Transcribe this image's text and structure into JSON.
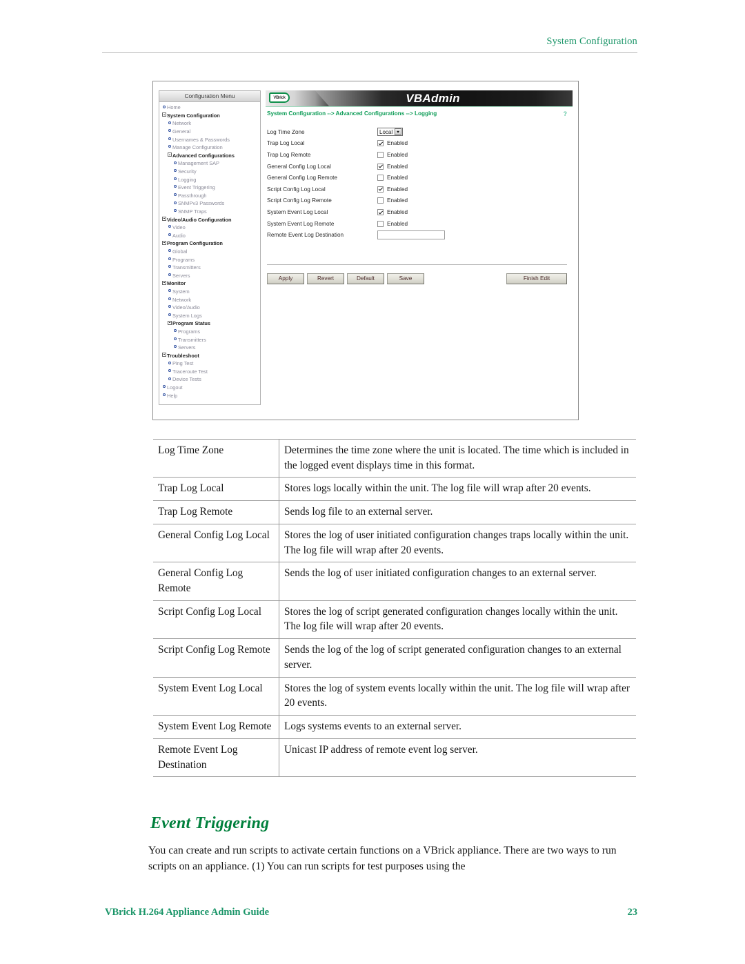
{
  "page": {
    "running_head": "System Configuration",
    "footer_left": "VBrick H.264 Appliance Admin Guide",
    "footer_page_number": "23"
  },
  "colors": {
    "brand_green": "#1a9568",
    "heading_green": "#00803c",
    "crumb_green": "#0f9d58",
    "help_link": "#62c7a4",
    "menu_link": "#8b8b99"
  },
  "figure": {
    "sidebar": {
      "title": "Configuration Menu",
      "items": [
        {
          "label": "Home",
          "level": 0,
          "marker": "dot",
          "bold": false
        },
        {
          "label": "System Configuration",
          "level": 0,
          "marker": "boxminus",
          "bold": true
        },
        {
          "label": "Network",
          "level": 1,
          "marker": "dot",
          "bold": false
        },
        {
          "label": "General",
          "level": 1,
          "marker": "dot",
          "bold": false
        },
        {
          "label": "Usernames & Passwords",
          "level": 1,
          "marker": "dot",
          "bold": false
        },
        {
          "label": "Manage Configuration",
          "level": 1,
          "marker": "dot",
          "bold": false
        },
        {
          "label": "Advanced Configurations",
          "level": 1,
          "marker": "boxminus",
          "bold": true
        },
        {
          "label": "Management SAP",
          "level": 2,
          "marker": "dot",
          "bold": false
        },
        {
          "label": "Security",
          "level": 2,
          "marker": "dot",
          "bold": false
        },
        {
          "label": "Logging",
          "level": 2,
          "marker": "dot",
          "bold": false
        },
        {
          "label": "Event Triggering",
          "level": 2,
          "marker": "dot",
          "bold": false
        },
        {
          "label": "Passthrough",
          "level": 2,
          "marker": "dot",
          "bold": false
        },
        {
          "label": "SNMPv3 Passwords",
          "level": 2,
          "marker": "dot",
          "bold": false
        },
        {
          "label": "SNMP Traps",
          "level": 2,
          "marker": "dot",
          "bold": false
        },
        {
          "label": "Video/Audio Configuration",
          "level": 0,
          "marker": "boxminus",
          "bold": true
        },
        {
          "label": "Video",
          "level": 1,
          "marker": "dot",
          "bold": false
        },
        {
          "label": "Audio",
          "level": 1,
          "marker": "dot",
          "bold": false
        },
        {
          "label": "Program Configuration",
          "level": 0,
          "marker": "boxminus",
          "bold": true
        },
        {
          "label": "Global",
          "level": 1,
          "marker": "dot",
          "bold": false
        },
        {
          "label": "Programs",
          "level": 1,
          "marker": "dot",
          "bold": false
        },
        {
          "label": "Transmitters",
          "level": 1,
          "marker": "dot",
          "bold": false
        },
        {
          "label": "Servers",
          "level": 1,
          "marker": "dot",
          "bold": false
        },
        {
          "label": "Monitor",
          "level": 0,
          "marker": "boxminus",
          "bold": true
        },
        {
          "label": "System",
          "level": 1,
          "marker": "dot",
          "bold": false
        },
        {
          "label": "Network",
          "level": 1,
          "marker": "dot",
          "bold": false
        },
        {
          "label": "Video/Audio",
          "level": 1,
          "marker": "dot",
          "bold": false
        },
        {
          "label": "System Logs",
          "level": 1,
          "marker": "dot",
          "bold": false
        },
        {
          "label": "Program Status",
          "level": 1,
          "marker": "boxminus",
          "bold": true
        },
        {
          "label": "Programs",
          "level": 2,
          "marker": "dot",
          "bold": false
        },
        {
          "label": "Transmitters",
          "level": 2,
          "marker": "dot",
          "bold": false
        },
        {
          "label": "Servers",
          "level": 2,
          "marker": "dot",
          "bold": false
        },
        {
          "label": "Troubleshoot",
          "level": 0,
          "marker": "boxminus",
          "bold": true
        },
        {
          "label": "Ping Test",
          "level": 1,
          "marker": "dot",
          "bold": false
        },
        {
          "label": "Traceroute Test",
          "level": 1,
          "marker": "dot",
          "bold": false
        },
        {
          "label": "Device Tests",
          "level": 1,
          "marker": "dot",
          "bold": false
        },
        {
          "label": "Logout",
          "level": 0,
          "marker": "dot",
          "bold": false
        },
        {
          "label": "Help",
          "level": 0,
          "marker": "dot",
          "bold": false
        }
      ]
    },
    "header": {
      "logo_text": "VBrick",
      "app_title": "VBAdmin",
      "breadcrumb": "System Configuration --> Advanced Configurations --> Logging",
      "help_link": "?"
    },
    "form": {
      "rows": [
        {
          "label": "Log Time Zone",
          "control": "select",
          "value": "Local"
        },
        {
          "label": "Trap Log Local",
          "control": "checkbox",
          "checked": true,
          "value": "Enabled"
        },
        {
          "label": "Trap Log Remote",
          "control": "checkbox",
          "checked": false,
          "value": "Enabled"
        },
        {
          "label": "General Config Log Local",
          "control": "checkbox",
          "checked": true,
          "value": "Enabled"
        },
        {
          "label": "General Config Log Remote",
          "control": "checkbox",
          "checked": false,
          "value": "Enabled"
        },
        {
          "label": "Script Config Log Local",
          "control": "checkbox",
          "checked": true,
          "value": "Enabled"
        },
        {
          "label": "Script Config Log Remote",
          "control": "checkbox",
          "checked": false,
          "value": "Enabled"
        },
        {
          "label": "System Event Log Local",
          "control": "checkbox",
          "checked": true,
          "value": "Enabled"
        },
        {
          "label": "System Event Log Remote",
          "control": "checkbox",
          "checked": false,
          "value": "Enabled"
        },
        {
          "label": "Remote Event Log Destination",
          "control": "text",
          "value": ""
        }
      ]
    },
    "buttons": {
      "apply": "Apply",
      "revert": "Revert",
      "default": "Default",
      "save": "Save",
      "finish_edit": "Finish Edit"
    }
  },
  "definition_table": {
    "rows": [
      {
        "term": "Log Time Zone",
        "description": "Determines the time zone where the unit is located. The time which is included in the logged event displays time in this format."
      },
      {
        "term": "Trap Log Local",
        "description": "Stores logs locally within the unit. The log file will wrap after 20 events."
      },
      {
        "term": "Trap Log Remote",
        "description": "Sends log file to an external server."
      },
      {
        "term": "General Config Log Local",
        "description": "Stores the log of user initiated configuration changes traps locally within the unit. The log file will wrap after 20 events."
      },
      {
        "term": "General Config Log Remote",
        "description": "Sends the log of user initiated configuration changes to an external server."
      },
      {
        "term": "Script Config Log Local",
        "description": "Stores the log of script generated configuration changes locally within the unit. The log file will wrap after 20 events."
      },
      {
        "term": "Script Config Log Remote",
        "description": "Sends the log of the log of script generated configuration changes to an external server."
      },
      {
        "term": "System Event Log Local",
        "description": "Stores the log of system events locally within the unit. The log file will wrap after 20 events."
      },
      {
        "term": "System Event Log Remote",
        "description": "Logs systems events to an external server."
      },
      {
        "term": "Remote Event Log Destination",
        "description": "Unicast IP address of remote event log server."
      }
    ]
  },
  "section": {
    "heading": "Event Triggering",
    "body": "You can create and run scripts to activate certain functions on a VBrick appliance. There are two ways to run scripts on an appliance. (1) You can run scripts for test purposes using the"
  }
}
